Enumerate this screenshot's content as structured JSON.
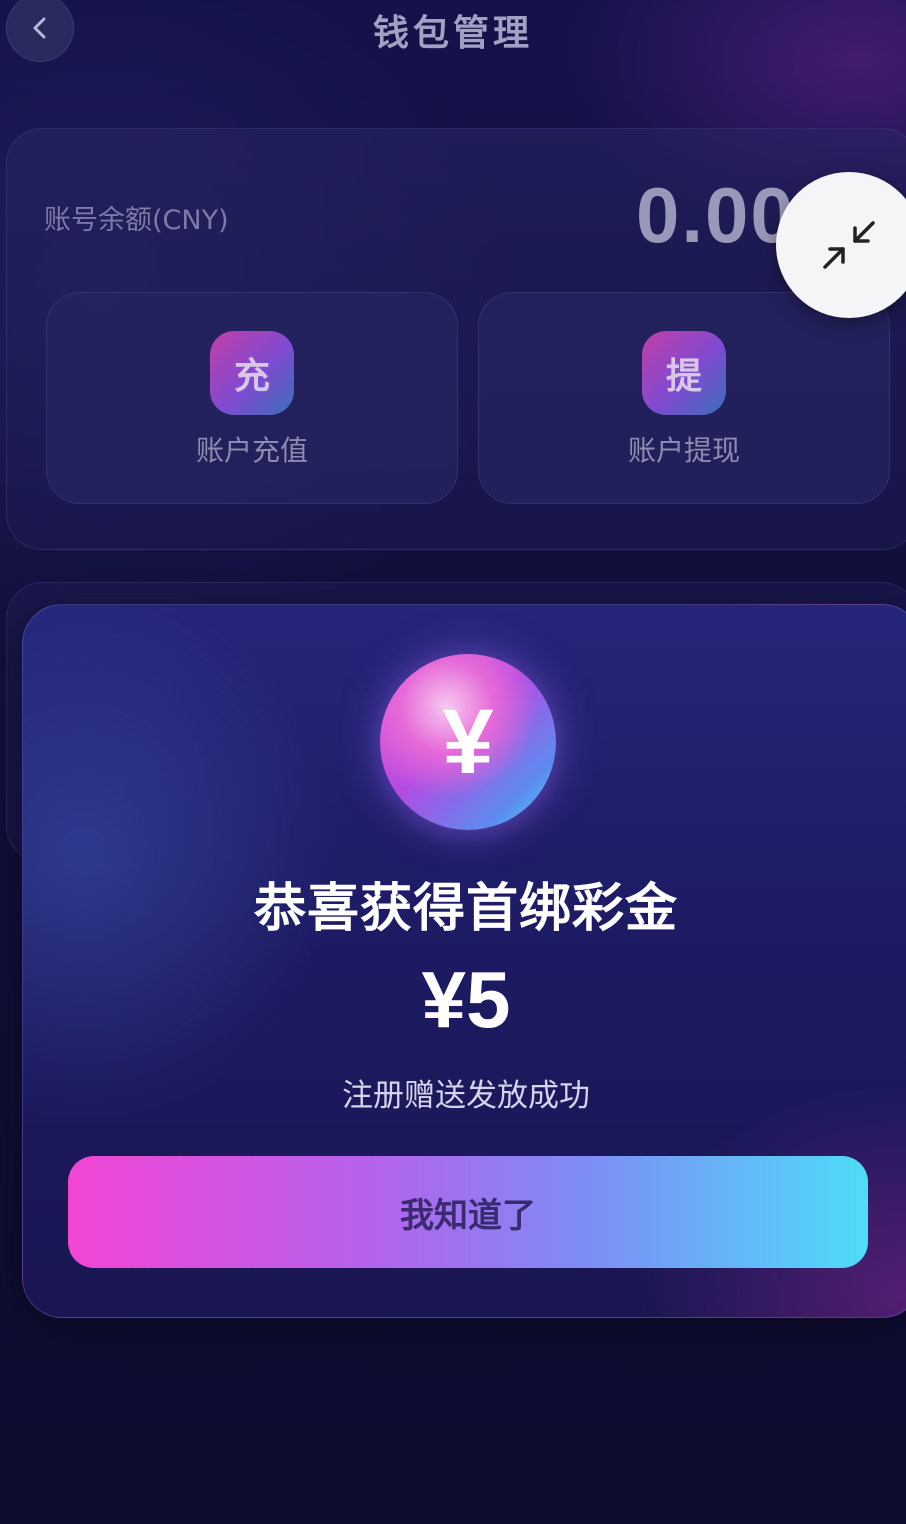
{
  "header": {
    "title": "钱包管理",
    "back_icon": "chevron-left-icon"
  },
  "wallet": {
    "balance_label": "账号余额(CNY)",
    "balance_value": "0.00",
    "actions": [
      {
        "icon_text": "充",
        "label": "账户充值"
      },
      {
        "icon_text": "提",
        "label": "账户提现"
      }
    ]
  },
  "floating": {
    "icon": "collapse-arrows-icon"
  },
  "modal": {
    "coin_symbol": "¥",
    "title": "恭喜获得首绑彩金",
    "amount": "¥5",
    "subtitle": "注册赠送发放成功",
    "confirm_label": "我知道了"
  },
  "colors": {
    "background": "#0e0c30",
    "gradient_start": "#f245d4",
    "gradient_end": "#4fdcf8"
  }
}
